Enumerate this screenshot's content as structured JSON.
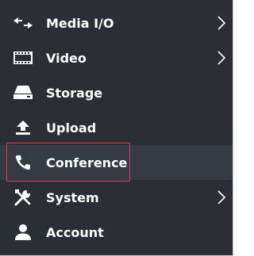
{
  "menu": {
    "items": [
      {
        "label": "Media I/O",
        "icon": "media-io-icon",
        "has_submenu": true
      },
      {
        "label": "Video",
        "icon": "film-icon",
        "has_submenu": true
      },
      {
        "label": "Storage",
        "icon": "drive-icon",
        "has_submenu": false
      },
      {
        "label": "Upload",
        "icon": "upload-icon",
        "has_submenu": false
      },
      {
        "label": "Conference",
        "icon": "phone-icon",
        "has_submenu": false
      },
      {
        "label": "System",
        "icon": "tools-icon",
        "has_submenu": true
      },
      {
        "label": "Account",
        "icon": "user-icon",
        "has_submenu": false
      }
    ],
    "active_item": "Conference"
  },
  "colors": {
    "background": "#2b2e35",
    "active_background": "#363a43",
    "text": "#ffffff",
    "highlight_border": "#d9434d"
  }
}
